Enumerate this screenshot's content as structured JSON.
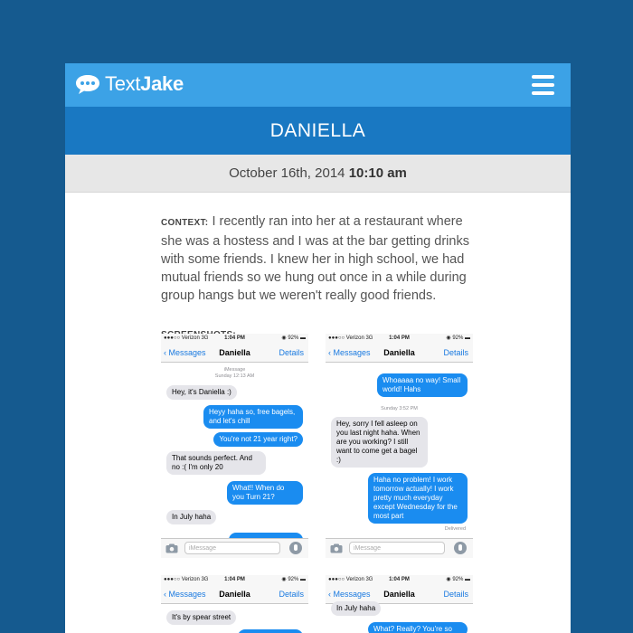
{
  "app": {
    "brand_light": "Text",
    "brand_bold": "Jake",
    "menu_icon": "hamburger-menu-icon",
    "logo_icon": "speech-bubble-icon",
    "colors": {
      "page_bg": "#155a8f",
      "topbar": "#3ca2e6",
      "namebar": "#1978c2",
      "imessage_blue": "#1a8cf0"
    }
  },
  "conversation": {
    "name": "DANIELLA",
    "date": "October 16th, 2014",
    "time": "10:10 am",
    "context_label": "CONTEXT:",
    "context_text": "I recently ran into her at a restaurant where she was a hostess and I was at the bar getting drinks with some friends. I knew her in high school, we had mutual friends so we hung out once in a while during group hangs but we weren't really good friends.",
    "screenshots_label": "SCREENSHOTS:"
  },
  "screenshots": [
    {
      "carrier": "●●●○○ Verizon  3G",
      "time": "1:04 PM",
      "battery": "◉ 92% ▬",
      "back": "Messages",
      "contact": "Daniella",
      "details": "Details",
      "meta_service": "iMessage",
      "meta_time": "Sunday 12:13 AM",
      "messages": [
        {
          "dir": "in",
          "text": "Hey, it's Daniella :)"
        },
        {
          "dir": "out",
          "text": "Heyy haha so, free bagels, and let's chill"
        },
        {
          "dir": "out",
          "text": "You're not 21 year right?"
        },
        {
          "dir": "in",
          "text": "That sounds perfect. And no :( I'm only 20"
        },
        {
          "dir": "out",
          "text": "What!! When do you Turn 21?"
        },
        {
          "dir": "in",
          "text": "In July haha"
        }
      ],
      "input_placeholder": "iMessage"
    },
    {
      "carrier": "●●●○○ Verizon  3G",
      "time": "1:04 PM",
      "battery": "◉ 92% ▬",
      "back": "Messages",
      "contact": "Daniella",
      "details": "Details",
      "meta_time": "Sunday 3:52 PM",
      "delivered": "Delivered",
      "messages": [
        {
          "dir": "out",
          "text": "Whoaaaa no way! Small world! Hahs"
        },
        {
          "dir": "in",
          "text": "Hey, sorry I fell asleep on you last night haha. When are you working? I still want to come get a bagel :)"
        },
        {
          "dir": "out",
          "text": "Haha no problem! I work tomorrow actually! I work pretty much everyday except Wednesday for the most part"
        }
      ],
      "input_placeholder": "iMessage"
    },
    {
      "carrier": "●●●○○ Verizon  3G",
      "time": "1:04 PM",
      "battery": "◉ 92% ▬",
      "back": "Messages",
      "contact": "Daniella",
      "details": "Details",
      "messages": [
        {
          "dir": "in",
          "text": "It's by spear street"
        }
      ]
    },
    {
      "carrier": "●●●○○ Verizon  3G",
      "time": "1:04 PM",
      "battery": "◉ 92% ▬",
      "back": "Messages",
      "contact": "Daniella",
      "details": "Details",
      "messages": [
        {
          "dir": "in",
          "text": "In July haha"
        },
        {
          "dir": "out",
          "text": "What? Really? You're so"
        }
      ]
    }
  ]
}
